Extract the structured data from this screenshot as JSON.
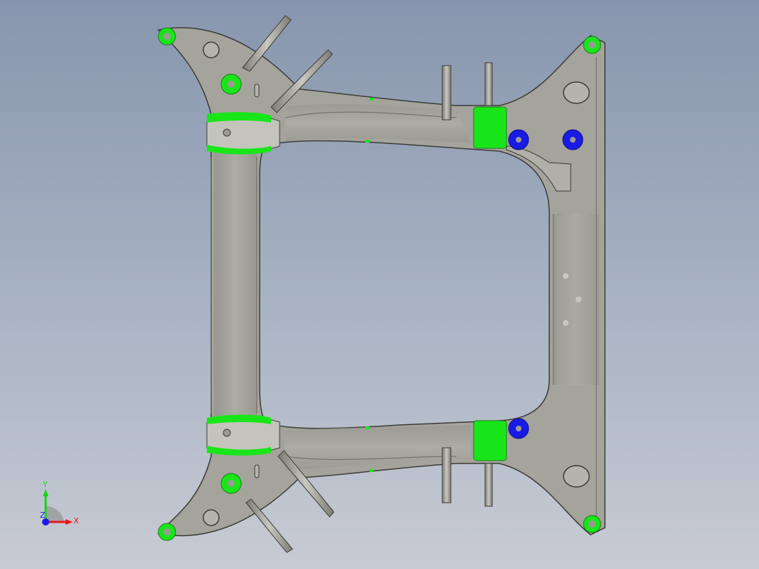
{
  "viewport": {
    "background_top": "#8796ae",
    "background_bottom": "#c7cbd3"
  },
  "model": {
    "part_color": "#a4a49c",
    "edge_color": "#3c3c38",
    "highlight_green": "#19e619",
    "highlight_blue": "#1a1ae6"
  },
  "triad": {
    "x_label": "X",
    "y_label": "Y",
    "z_label": "Z",
    "x_color": "#e61a1a",
    "y_color": "#1ad21a",
    "z_color": "#1a1ae6"
  }
}
